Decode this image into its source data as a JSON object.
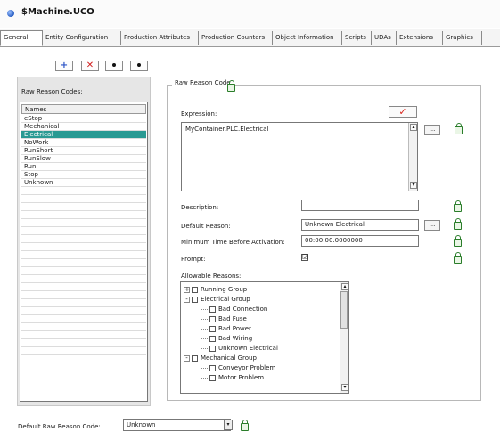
{
  "window": {
    "title": "$Machine.UCO"
  },
  "tabs": [
    {
      "label": "General"
    },
    {
      "label": "Entity Configuration"
    },
    {
      "label": "Production Attributes"
    },
    {
      "label": "Production Counters"
    },
    {
      "label": "Object Information"
    },
    {
      "label": "Scripts"
    },
    {
      "label": "UDAs"
    },
    {
      "label": "Extensions"
    },
    {
      "label": "Graphics"
    }
  ],
  "toolbar": {
    "add_glyph": "+",
    "delete_glyph": "✕"
  },
  "raw_reason_codes": {
    "label": "Raw Reason Codes:",
    "header": "Names",
    "items": [
      "eStop",
      "Mechanical",
      "Electrical",
      "NoWork",
      "RunShort",
      "RunSlow",
      "Run",
      "Stop",
      "Unknown"
    ],
    "selected": "Electrical"
  },
  "groupbox": {
    "title": "Raw Reason Code"
  },
  "expression": {
    "label": "Expression:",
    "value": "MyContainer.PLC.Electrical",
    "check_glyph": "✓",
    "ellipsis": "..."
  },
  "description": {
    "label": "Description:",
    "value": ""
  },
  "default_reason": {
    "label": "Default Reason:",
    "value": "Unknown Electrical",
    "ellipsis": "..."
  },
  "min_time": {
    "label": "Minimum Time Before Activation:",
    "value": "00:00:00.0000000"
  },
  "prompt": {
    "label": "Prompt:",
    "checked": true,
    "glyph": "☑"
  },
  "allowable": {
    "label": "Allowable Reasons:",
    "tree": [
      {
        "label": "Running Group",
        "exp": "+"
      },
      {
        "label": "Electrical Group",
        "exp": "-"
      },
      {
        "label": "Bad Connection"
      },
      {
        "label": "Bad Fuse"
      },
      {
        "label": "Bad Power"
      },
      {
        "label": "Bad Wiring"
      },
      {
        "label": "Unknown Electrical"
      },
      {
        "label": "Mechanical Group",
        "exp": "-"
      },
      {
        "label": "Conveyor Problem"
      },
      {
        "label": "Motor Problem"
      }
    ]
  },
  "default_raw_reason": {
    "label": "Default Raw Reason Code:",
    "value": "Unknown"
  },
  "icons": {
    "lock": "lock-icon",
    "scroll_up": "▴",
    "scroll_down": "▾",
    "dropdown": "▾"
  },
  "colors": {
    "selection": "#2a9a93",
    "validate": "#d9261c",
    "lock": "#2a7d2a"
  }
}
